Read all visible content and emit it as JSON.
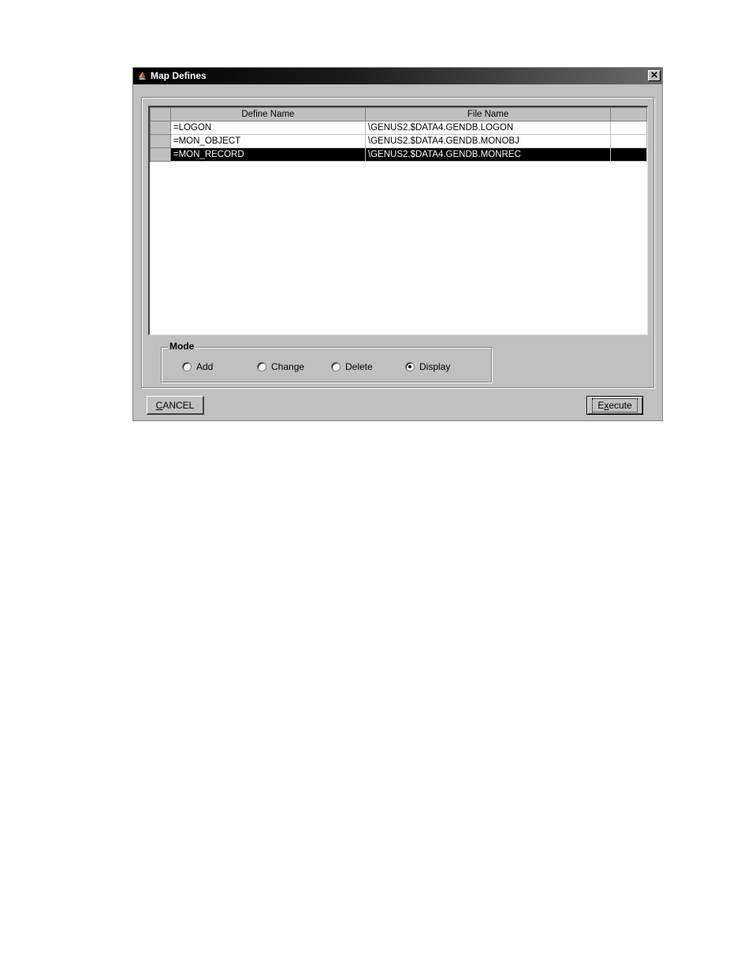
{
  "window": {
    "title": "Map Defines",
    "icon": "app-icon",
    "close_label": "✕"
  },
  "grid": {
    "columns": [
      "Define Name",
      "File Name",
      ""
    ],
    "rows": [
      {
        "define_name": "=LOGON",
        "file_name": "\\GENUS2.$DATA4.GENDB.LOGON",
        "selected": false
      },
      {
        "define_name": "=MON_OBJECT",
        "file_name": "\\GENUS2.$DATA4.GENDB.MONOBJ",
        "selected": false
      },
      {
        "define_name": "=MON_RECORD",
        "file_name": "\\GENUS2.$DATA4.GENDB.MONREC",
        "selected": true
      }
    ]
  },
  "mode": {
    "legend": "Mode",
    "options": [
      {
        "label": "Add",
        "checked": false
      },
      {
        "label": "Change",
        "checked": false
      },
      {
        "label": "Delete",
        "checked": false
      },
      {
        "label": "Display",
        "checked": true
      }
    ]
  },
  "buttons": {
    "cancel": {
      "accel": "C",
      "rest": "ANCEL"
    },
    "execute": {
      "pre": "E",
      "accel": "x",
      "rest": "ecute"
    }
  }
}
